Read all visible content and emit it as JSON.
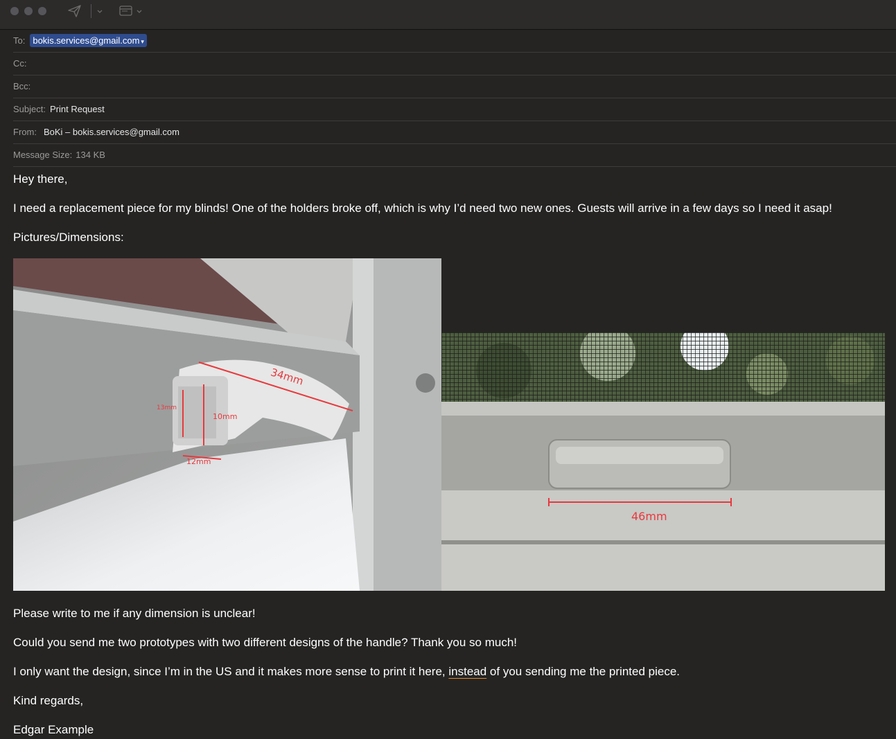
{
  "toolbar": {
    "icons": [
      "close-dot",
      "minimize-dot",
      "zoom-dot",
      "send-icon",
      "chevron-down-icon",
      "format-icon",
      "chevron-down-icon"
    ]
  },
  "header": {
    "to_label": "To:",
    "to_value": "bokis.services@gmail.com",
    "cc_label": "Cc:",
    "bcc_label": "Bcc:",
    "subject_label": "Subject:",
    "subject_value": "Print Request",
    "from_label": "From:",
    "from_value": "BoKi – bokis.services@gmail.com",
    "size_label": "Message Size:",
    "size_value": "134 KB"
  },
  "body": {
    "greeting": "Hey there,",
    "p1": "I need a replacement piece for my blinds! One of the holders broke off, which is why I’d need two new ones. Guests will arrive in a few days so I need it asap!",
    "p2": "Pictures/Dimensions:",
    "p3": "Please write to me if any dimension is unclear!",
    "p4": "Could you send me two prototypes with two different designs of the handle? Thank you so much!",
    "p5_before": "I only want the design, since I’m in the US and it makes more sense to print it here, ",
    "p5_underlined": "instead",
    "p5_after": " of you sending me the printed piece.",
    "closing": "Kind regards,",
    "signature": "Edgar Example"
  },
  "photos": {
    "left_labels": {
      "length": "34mm",
      "height_outer": "13mm",
      "height_inner": "10mm",
      "width": "12mm"
    },
    "right_labels": {
      "width": "46mm"
    }
  },
  "colors": {
    "background": "#252423",
    "chip": "#2f4c8f",
    "measure_red": "#e8393e",
    "spell_underline": "#e0872b"
  }
}
